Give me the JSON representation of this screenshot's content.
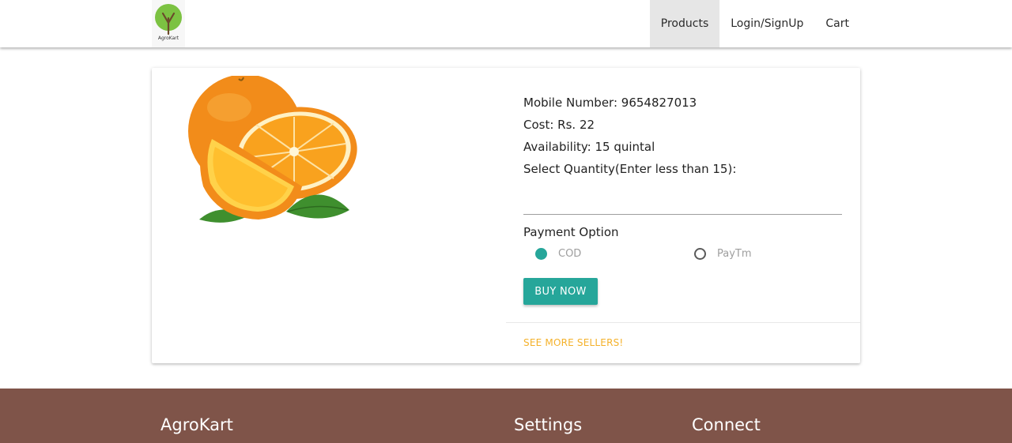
{
  "brand": {
    "name": "AgroKart",
    "icon": "tree-icon",
    "color": "#7cc242"
  },
  "nav": {
    "items": [
      {
        "label": "Products",
        "active": true
      },
      {
        "label": "Login/SignUp",
        "active": false
      },
      {
        "label": "Cart",
        "active": false
      }
    ]
  },
  "product": {
    "image": "orange-image",
    "mobile": "Mobile Number: 9654827013",
    "cost": "Cost: Rs. 22",
    "availability": "Availability: 15 quintal",
    "quantity_label": "Select Quantity(Enter less than 15):",
    "quantity_value": ""
  },
  "payment": {
    "label": "Payment Option",
    "options": [
      {
        "label": "COD",
        "checked": true
      },
      {
        "label": "PayTm",
        "checked": false
      }
    ]
  },
  "actions": {
    "buy_label": "BUY NOW",
    "more_sellers_label": "SEE MORE SELLERS!"
  },
  "footer": {
    "sections": [
      "AgroKart",
      "Settings",
      "Connect"
    ]
  },
  "colors": {
    "accent": "#26a69a",
    "link": "#f4b12a",
    "footer": "#7f5449"
  }
}
